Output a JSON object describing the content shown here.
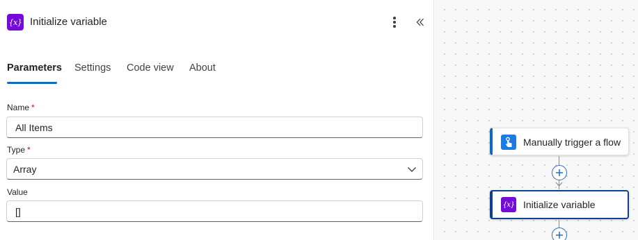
{
  "panel": {
    "icon": "variable-icon",
    "icon_glyph": "{x}",
    "title": "Initialize variable",
    "more_icon": "more-vertical-icon",
    "collapse_icon": "double-chevron-left-icon"
  },
  "tabs": [
    {
      "label": "Parameters",
      "active": true
    },
    {
      "label": "Settings",
      "active": false
    },
    {
      "label": "Code view",
      "active": false
    },
    {
      "label": "About",
      "active": false
    }
  ],
  "fields": {
    "name": {
      "label": "Name",
      "required_mark": "*",
      "value": "All Items"
    },
    "type": {
      "label": "Type",
      "required_mark": "*",
      "value": "Array",
      "icon": "chevron-down-icon"
    },
    "value": {
      "label": "Value",
      "value": "[]"
    }
  },
  "canvas": {
    "nodes": [
      {
        "label": "Manually trigger a flow",
        "icon": "touch-trigger-icon",
        "accent": "#0f6cbd"
      },
      {
        "label": "Initialize variable",
        "icon": "variable-icon",
        "icon_glyph": "{x}",
        "accent": "#0f3f8f",
        "selected": true
      }
    ],
    "add_icon": "plus-icon"
  },
  "colors": {
    "brand_purple": "#770bd6",
    "tab_active": "#0f6cbd",
    "required": "#c50f1f",
    "trigger_blue": "#1d7ae0"
  }
}
